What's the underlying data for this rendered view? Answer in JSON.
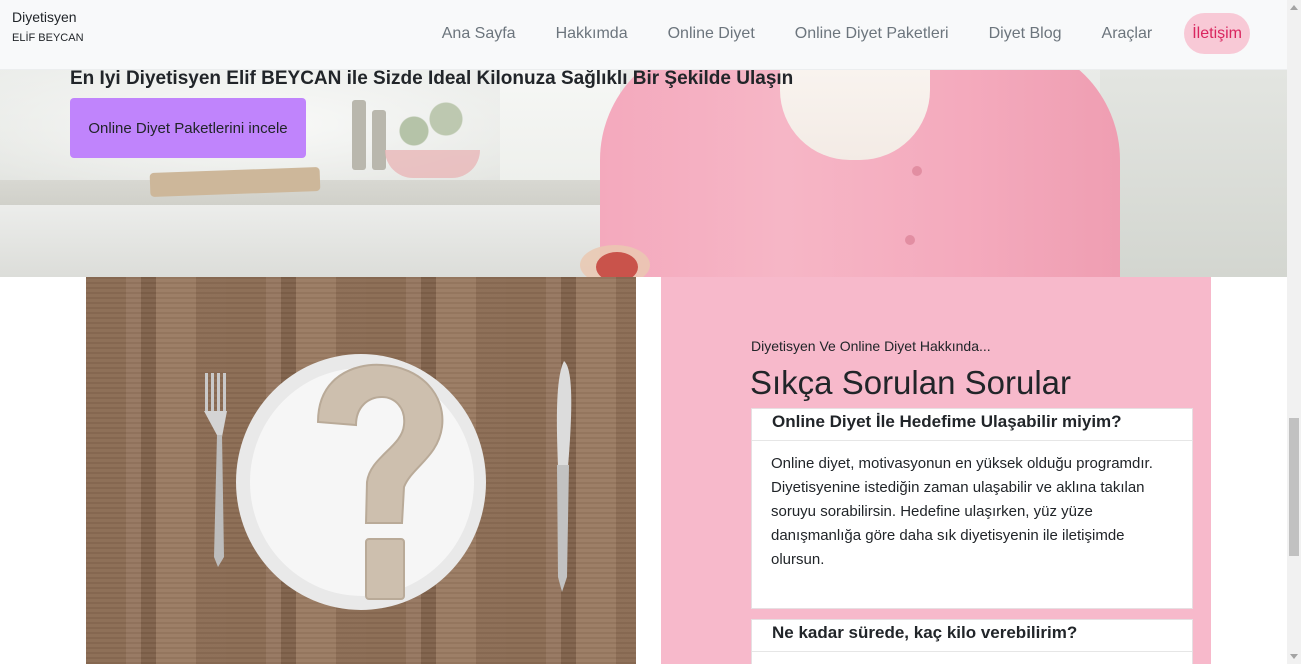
{
  "navbar": {
    "brand_name": "Diyetisyen",
    "brand_sub": "ELİF BEYCAN",
    "items": [
      {
        "label": "Ana Sayfa"
      },
      {
        "label": "Hakkımda"
      },
      {
        "label": "Online Diyet"
      },
      {
        "label": "Online Diyet Paketleri"
      },
      {
        "label": "Diyet Blog"
      },
      {
        "label": "Araçlar"
      },
      {
        "label": "İletişim",
        "active": true
      }
    ],
    "active_color": "#d9265f",
    "active_bg": "#f8c9d6"
  },
  "hero": {
    "title": "En İyi Diyetisyen Elif BEYCAN ile Sizde İdeal Kilonuza Sağlıklı Bir Şekilde Ulaşın",
    "button_label": "Online Diyet Paketlerini incele",
    "button_color": "#c084fc"
  },
  "faq": {
    "eyebrow": "Diyetisyen Ve Online Diyet Hakkında...",
    "title": "Sıkça Sorulan Sorular",
    "panel_color": "#f7b9cb",
    "items": [
      {
        "question": "Online Diyet İle Hedefime Ulaşabilir miyim?",
        "answer": "Online diyet, motivasyonun en yüksek olduğu programdır. Diyetisyenine istediğin zaman ulaşabilir ve aklına takılan soruyu sorabilirsin. Hedefine ulaşırken, yüz yüze danışmanlığa göre daha sık diyetisyenin ile iletişimde olursun.",
        "expanded": true
      },
      {
        "question": "Ne kadar sürede, kaç kilo verebilirim?",
        "answer": "",
        "expanded": false
      }
    ]
  },
  "icons": {
    "plate_image": "question-mark-plate-image",
    "fork": "fork-icon",
    "knife": "knife-icon"
  }
}
